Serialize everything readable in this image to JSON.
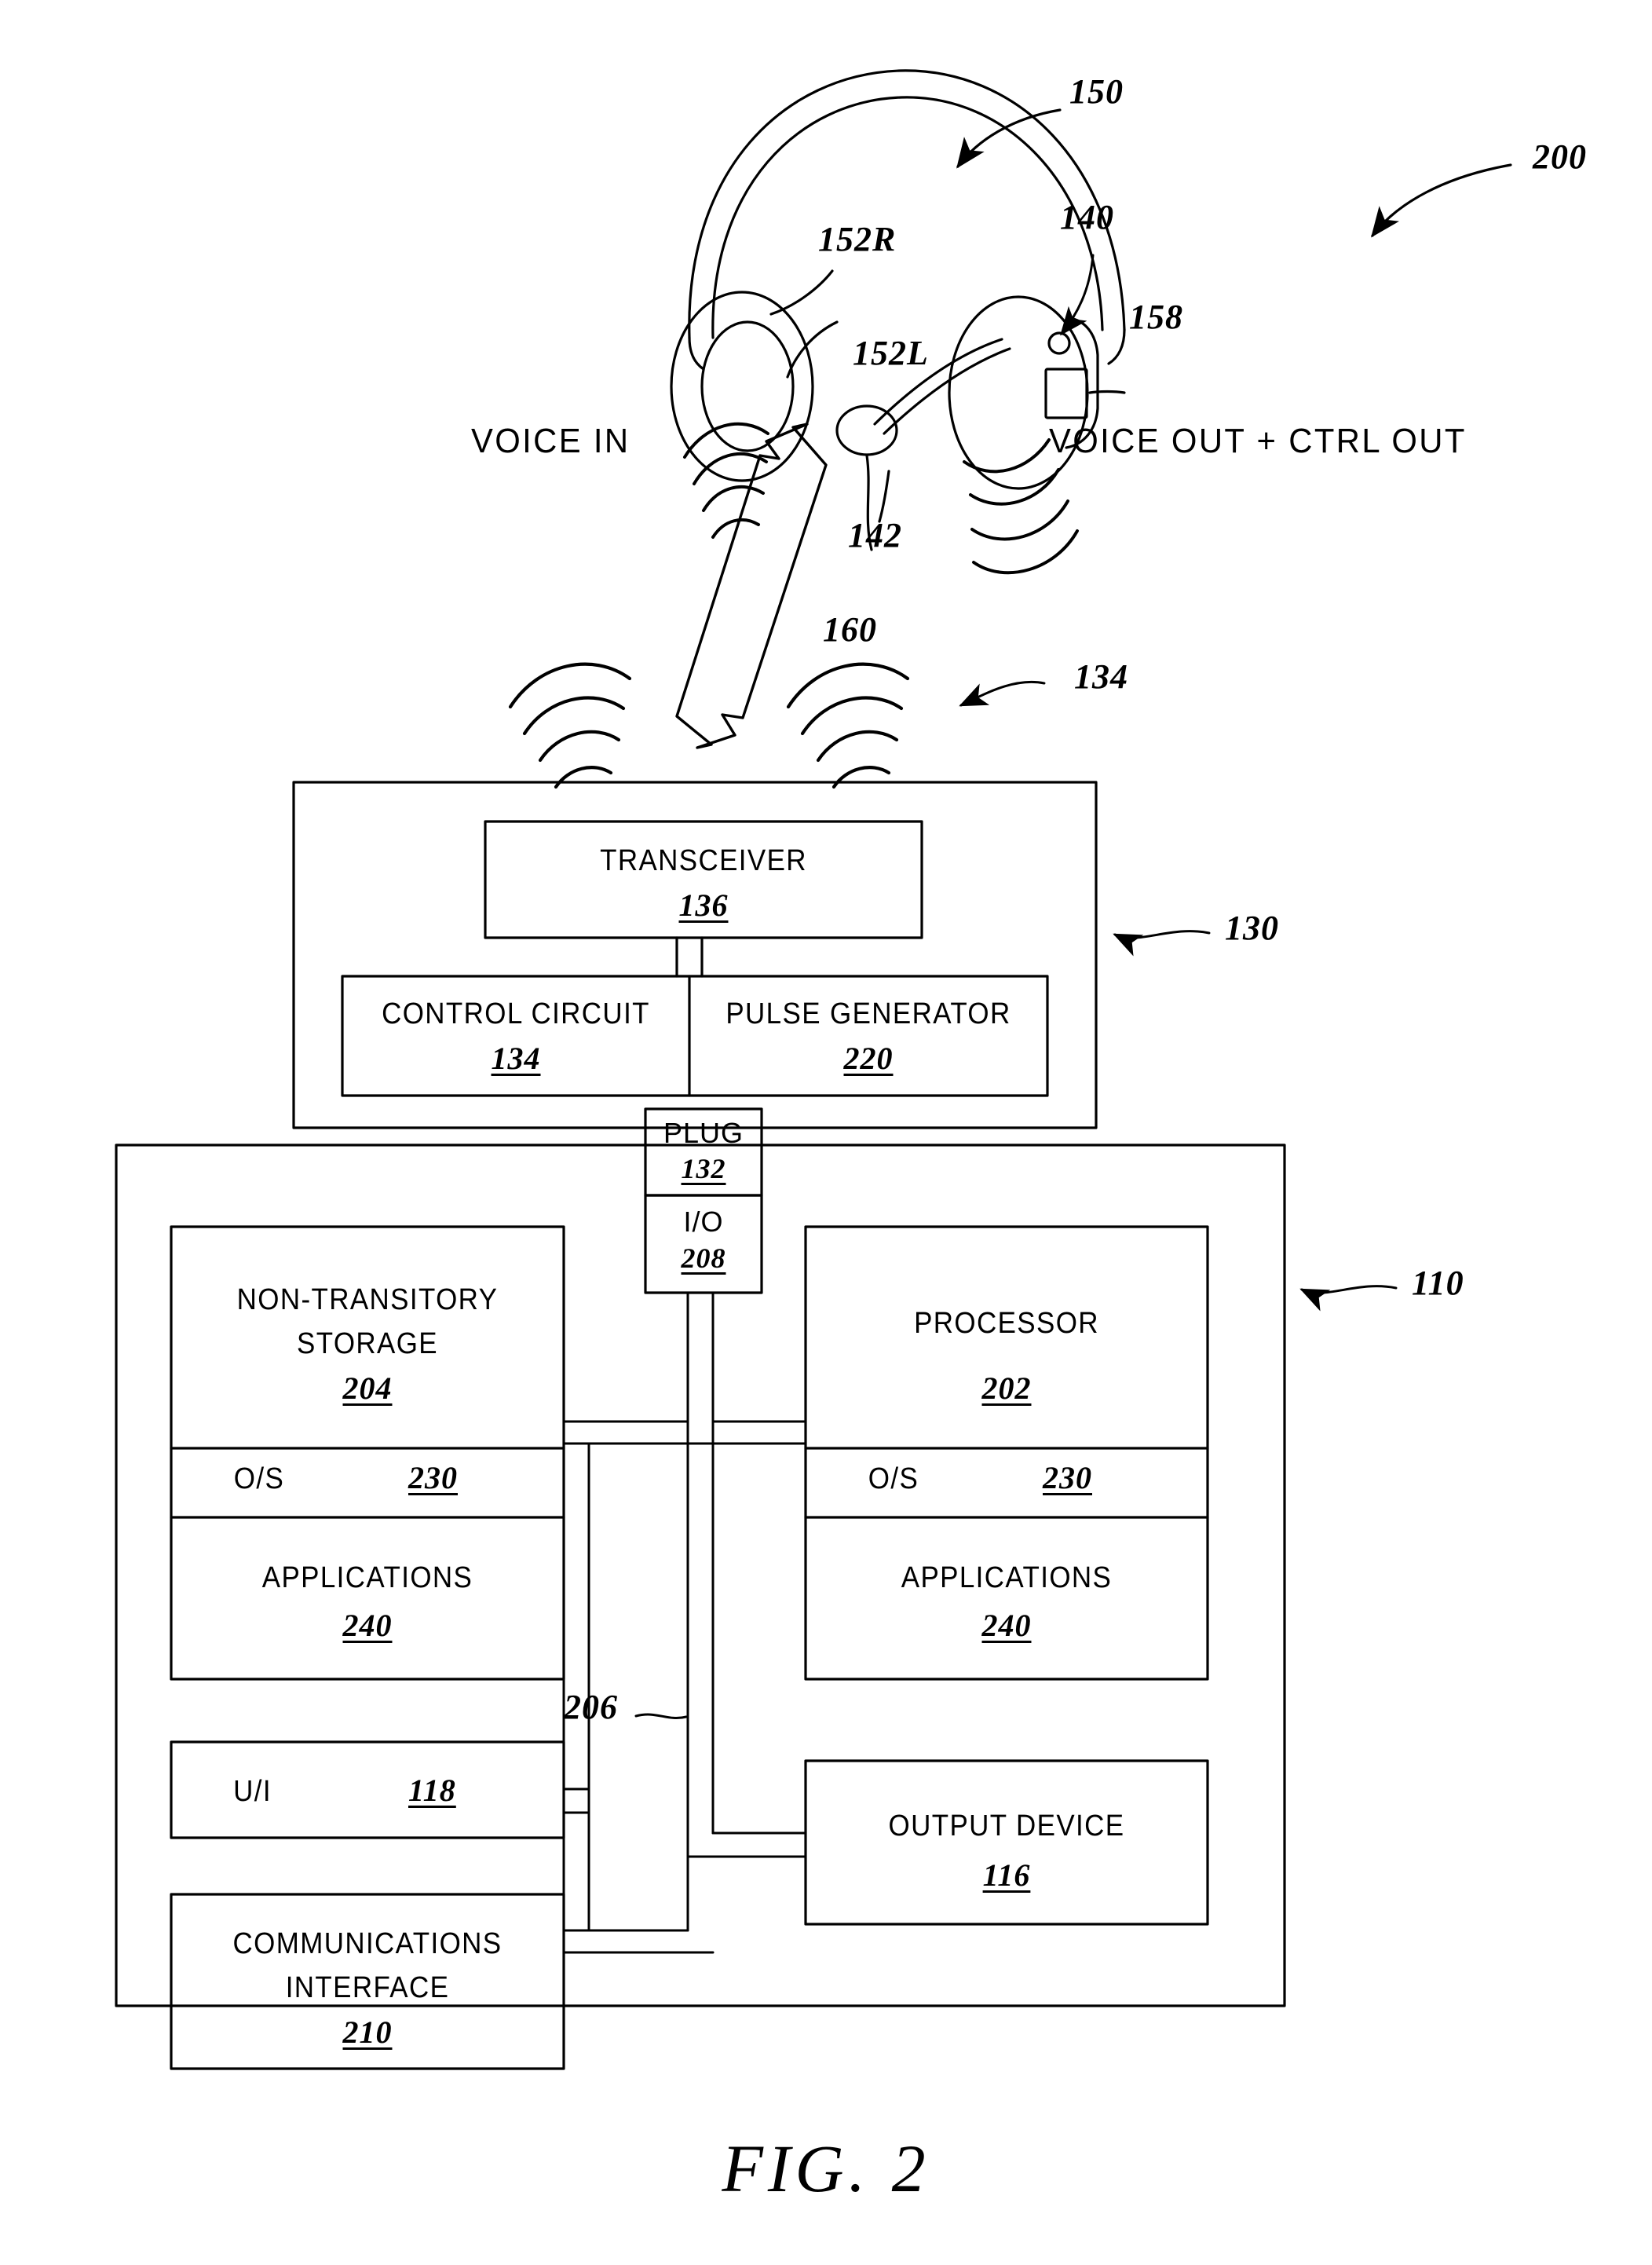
{
  "figure": {
    "caption": "FIG. 2",
    "system_ref": "200"
  },
  "headset": {
    "ref": "150",
    "earcup_right_ref": "152R",
    "earcup_left_ref": "152L",
    "control_module_ref": "140",
    "button_ref": "158",
    "microphone_ref": "142"
  },
  "signals": {
    "voice_in": "VOICE IN",
    "voice_out": "VOICE OUT + CTRL OUT",
    "wireless_link_ref": "160",
    "wireless_waves_ref": "134"
  },
  "adapter": {
    "ref": "130",
    "transceiver": {
      "label": "TRANSCEIVER",
      "ref": "136"
    },
    "control_circuit": {
      "label": "CONTROL CIRCUIT",
      "ref": "134"
    },
    "pulse_generator": {
      "label": "PULSE GENERATOR",
      "ref": "220"
    },
    "plug": {
      "label": "PLUG",
      "ref": "132"
    }
  },
  "device": {
    "ref": "110",
    "io": {
      "label": "I/O",
      "ref": "208"
    },
    "bus_ref": "206",
    "storage": {
      "label_line1": "NON-TRANSITORY",
      "label_line2": "STORAGE",
      "ref": "204",
      "os": {
        "label": "O/S",
        "ref": "230"
      },
      "applications": {
        "label": "APPLICATIONS",
        "ref": "240"
      }
    },
    "processor": {
      "label": "PROCESSOR",
      "ref": "202",
      "os": {
        "label": "O/S",
        "ref": "230"
      },
      "applications": {
        "label": "APPLICATIONS",
        "ref": "240"
      }
    },
    "ui": {
      "label": "U/I",
      "ref": "118"
    },
    "communications_interface": {
      "label_line1": "COMMUNICATIONS",
      "label_line2": "INTERFACE",
      "ref": "210"
    },
    "output_device": {
      "label": "OUTPUT DEVICE",
      "ref": "116"
    }
  },
  "style": {
    "ink": "#000000",
    "paper": "#ffffff"
  }
}
